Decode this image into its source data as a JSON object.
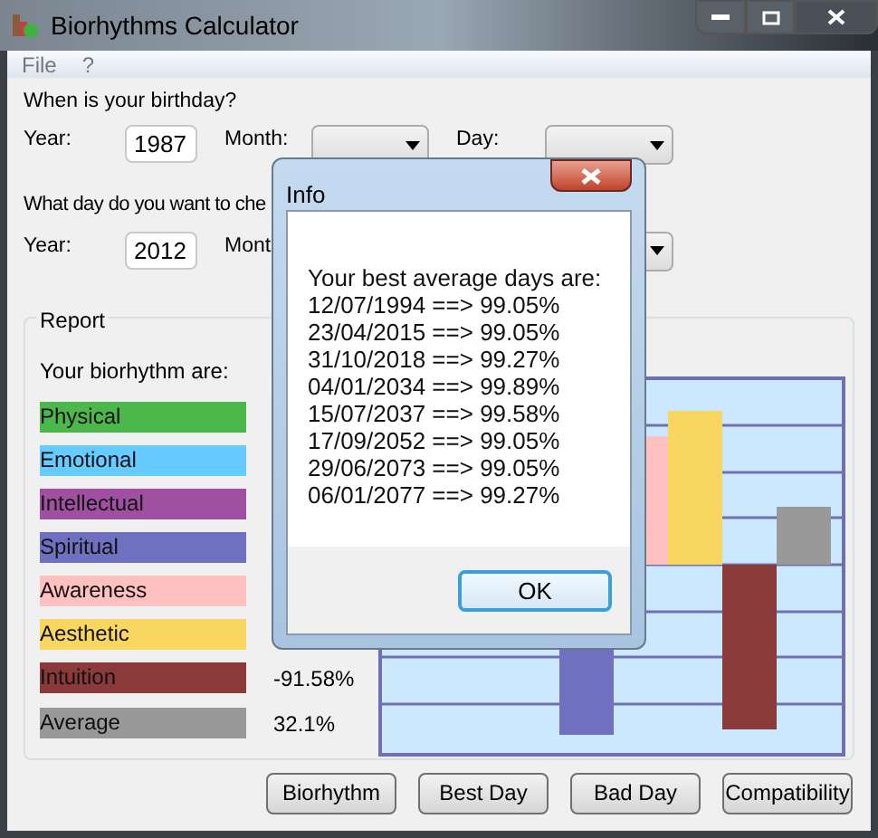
{
  "window": {
    "title": "Biorhythms Calculator"
  },
  "menu": [
    "File",
    "?"
  ],
  "birthday": {
    "question": "When is your birthday?",
    "year_label": "Year:",
    "year": "1987",
    "month_label": "Month:",
    "day_label": "Day:"
  },
  "check_date": {
    "question": "What day do you want to che",
    "year_label": "Year:",
    "year": "2012",
    "month_label": "Mont"
  },
  "report": {
    "title": "Report",
    "subtitle": "Your biorhythm are:",
    "items": [
      {
        "name": "Physical",
        "color": "#4cb84c"
      },
      {
        "name": "Emotional",
        "color": "#66ccff"
      },
      {
        "name": "Intellectual",
        "color": "#a050a0"
      },
      {
        "name": "Spiritual",
        "color": "#7070c0"
      },
      {
        "name": "Awareness",
        "color": "#ffc0c0"
      },
      {
        "name": "Aesthetic",
        "color": "#f8d660"
      },
      {
        "name": "Intuition",
        "color": "#8b3a3a",
        "reading": "-91.58%"
      },
      {
        "name": "Average",
        "color": "#999999",
        "reading": "32.1%"
      }
    ]
  },
  "buttons": [
    "Biorhythm",
    "Best Day",
    "Bad Day",
    "Compatibility"
  ],
  "dialog": {
    "title": "Info",
    "heading": "Your best average days are:",
    "lines": [
      "12/07/1994 ==> 99.05%",
      "23/04/2015 ==> 99.05%",
      "31/10/2018 ==> 99.27%",
      "04/01/2034 ==> 99.89%",
      "15/07/2037 ==> 99.58%",
      "17/09/2052 ==> 99.05%",
      "29/06/2073 ==> 99.05%",
      "06/01/2077 ==> 99.27%"
    ],
    "ok": "OK"
  }
}
